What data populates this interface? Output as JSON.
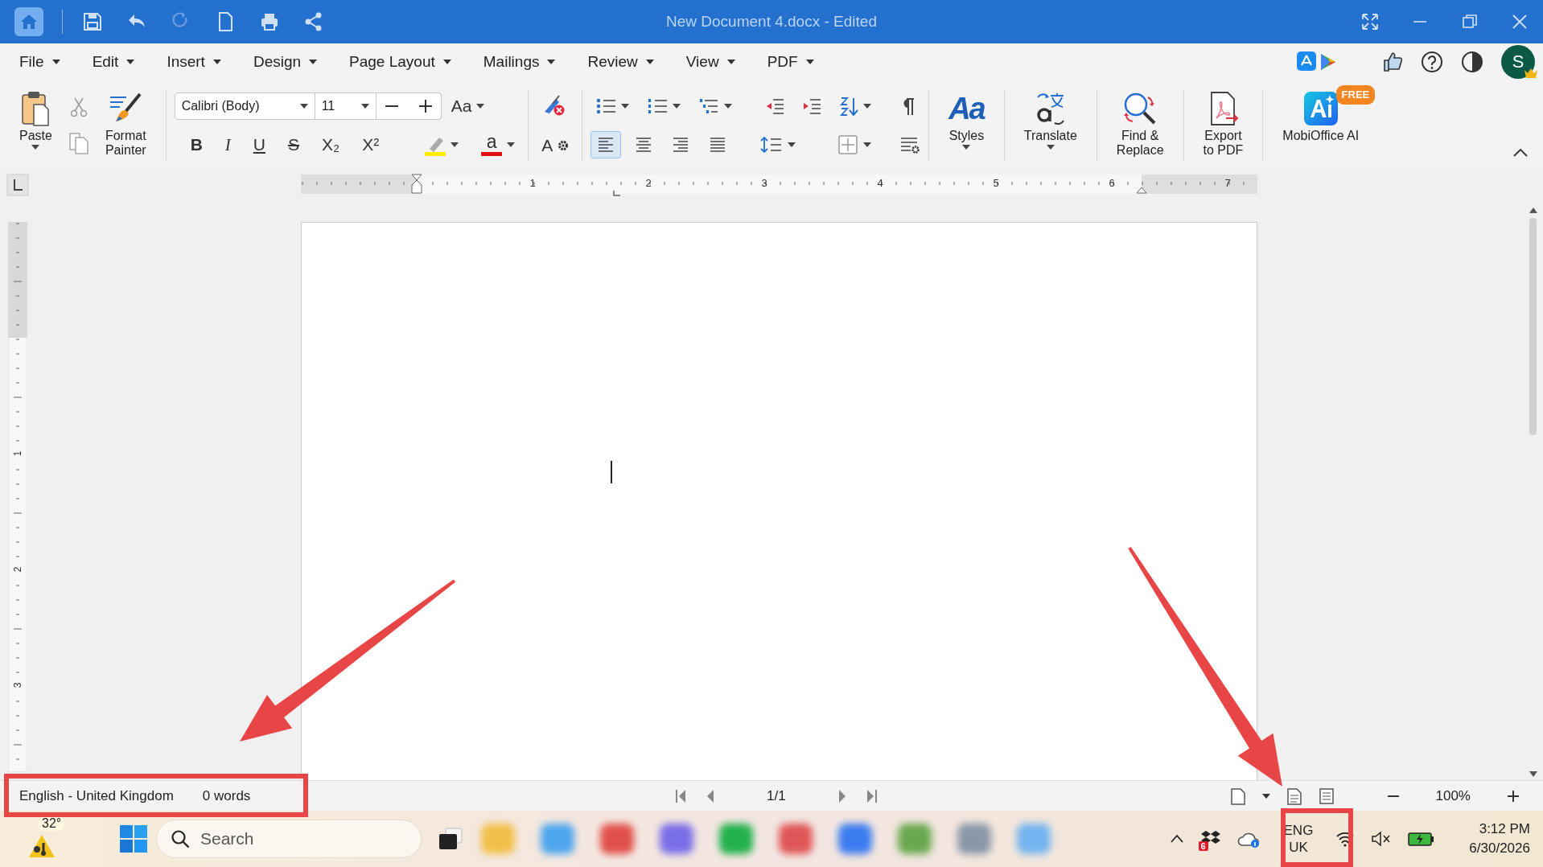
{
  "title_bar": {
    "title": "New Document 4.docx - Edited",
    "quick_access": [
      {
        "kind": "save",
        "disabled": false
      },
      {
        "kind": "undo",
        "disabled": false
      },
      {
        "kind": "redo",
        "disabled": true
      },
      {
        "kind": "new",
        "disabled": false
      },
      {
        "kind": "print",
        "disabled": false
      },
      {
        "kind": "share",
        "disabled": false
      }
    ]
  },
  "menu": [
    {
      "label": "File"
    },
    {
      "label": "Edit"
    },
    {
      "label": "Insert"
    },
    {
      "label": "Design"
    },
    {
      "label": "Page Layout"
    },
    {
      "label": "Mailings"
    },
    {
      "label": "Review"
    },
    {
      "label": "View"
    },
    {
      "label": "PDF"
    }
  ],
  "account": {
    "initial": "S"
  },
  "ribbon": {
    "paste": "Paste",
    "format_painter": "Format\nPainter",
    "font": {
      "name": "Calibri (Body)",
      "size": "11",
      "case": "Aa"
    },
    "formats": [
      {
        "kind": "bold",
        "label": "B"
      },
      {
        "kind": "italic",
        "label": "I"
      },
      {
        "kind": "underline",
        "label": "U"
      },
      {
        "kind": "strike",
        "label": "S"
      },
      {
        "kind": "sub",
        "label": "X₂"
      },
      {
        "kind": "sup",
        "label": "X²"
      }
    ],
    "highlight": {
      "color": "#ffee00"
    },
    "font_color": {
      "label": "a",
      "color": "#e01010"
    },
    "text_effects": {
      "label": "A"
    },
    "alignment": [
      {
        "kind": "left",
        "selected": true
      },
      {
        "kind": "center",
        "selected": false
      },
      {
        "kind": "right",
        "selected": false
      },
      {
        "kind": "justify",
        "selected": false
      }
    ],
    "large_buttons": [
      {
        "kind": "styles",
        "label": "Styles",
        "glyph": "Aa",
        "dropdown": true
      },
      {
        "kind": "translate",
        "label": "Translate",
        "dropdown": true
      },
      {
        "kind": "find",
        "label": "Find &\nReplace",
        "dropdown": false
      },
      {
        "kind": "export",
        "label": "Export\nto PDF",
        "dropdown": false
      },
      {
        "kind": "ai",
        "label": "MobiOffice AI",
        "dropdown": false,
        "badge": "FREE"
      }
    ]
  },
  "ruler": {
    "numbers": [
      "1",
      "2",
      "3",
      "4",
      "5",
      "6",
      "7"
    ]
  },
  "vertical_ruler": {
    "numbers": [
      "1",
      "2",
      "3"
    ]
  },
  "status_bar": {
    "language": "English - United Kingdom",
    "words": "0 words",
    "page": "1/1",
    "zoom": "100%"
  },
  "taskbar": {
    "weather": "32°",
    "search": {
      "placeholder": "Search"
    },
    "apps": [
      {
        "color": "#f2c04a"
      },
      {
        "color": "#4ea6ee"
      },
      {
        "color": "#e0504a"
      },
      {
        "color": "#7a6ee8"
      },
      {
        "color": "#22b14c"
      },
      {
        "color": "#e05656"
      },
      {
        "color": "#3b7cf0"
      },
      {
        "color": "#6aa84f"
      },
      {
        "color": "#8a97a8"
      },
      {
        "color": "#74b4f0"
      }
    ],
    "dropbox_badge": "6",
    "language": [
      "ENG",
      "UK"
    ],
    "time": "3:12 PM",
    "date": "6/30/2026"
  },
  "annotations": [
    {
      "kind": "arrow"
    },
    {
      "kind": "arrow"
    },
    {
      "kind": "frame"
    },
    {
      "kind": "frame"
    }
  ]
}
